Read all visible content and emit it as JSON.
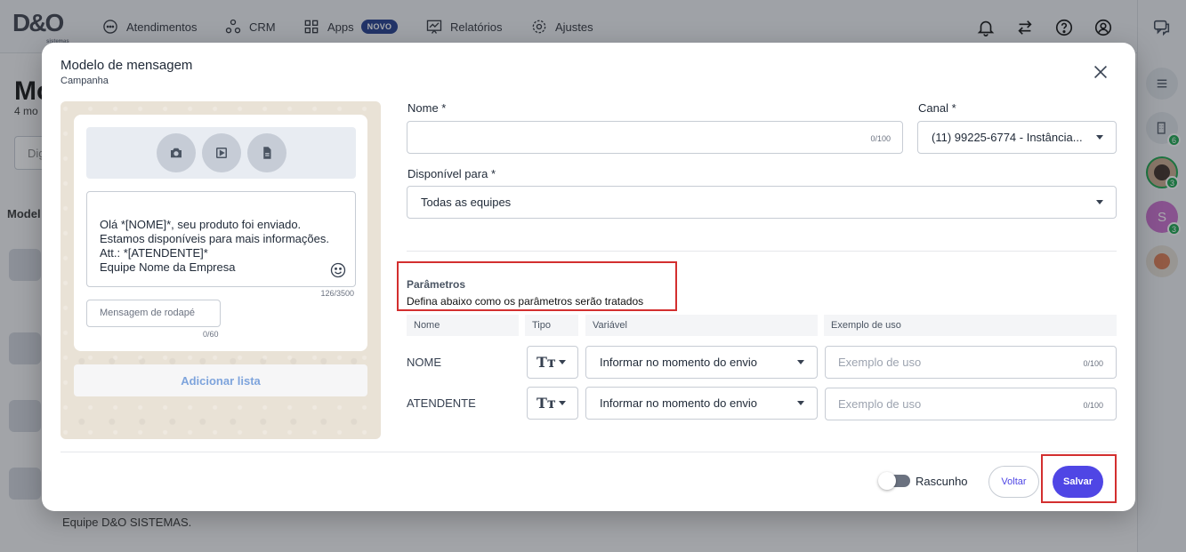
{
  "topnav": {
    "logo": "D&O",
    "logo_sub": "sistemas",
    "items": [
      {
        "label": "Atendimentos"
      },
      {
        "label": "CRM"
      },
      {
        "label": "Apps",
        "badge": "NOVO"
      },
      {
        "label": "Relatórios"
      },
      {
        "label": "Ajustes"
      }
    ]
  },
  "rail": {
    "counts": [
      "6",
      "3",
      "3"
    ],
    "avatar_letter": "S"
  },
  "background": {
    "title": "Mo",
    "subtitle": "4 mo",
    "search_placeholder": "Dig",
    "column": "Model",
    "footer_text": "Equipe D&O SISTEMAS."
  },
  "modal": {
    "title": "Modelo de mensagem",
    "subtitle": "Campanha",
    "preview": {
      "message": "Olá *[NOME]*, seu produto foi enviado.\nEstamos disponíveis para mais informações.\nAtt.: *[ATENDENTE]*\nEquipe Nome da Empresa",
      "message_count": "126/3500",
      "footer_placeholder": "Mensagem de rodapé",
      "footer_count": "0/60",
      "add_list_label": "Adicionar lista"
    },
    "form": {
      "name_label": "Nome *",
      "name_value": "",
      "name_count": "0/100",
      "channel_label": "Canal *",
      "channel_value": "(11) 99225-6774 - Instância...",
      "available_label": "Disponível para *",
      "available_value": "Todas as equipes"
    },
    "params": {
      "title": "Parâmetros",
      "description": "Defina abaixo como os parâmetros serão tratados",
      "headers": {
        "name": "Nome",
        "type": "Tipo",
        "variable": "Variável",
        "example": "Exemplo de uso"
      },
      "rows": [
        {
          "name": "NOME",
          "type_glyph": "Tт",
          "variable": "Informar no momento do envio",
          "example_placeholder": "Exemplo de uso",
          "example_count": "0/100"
        },
        {
          "name": "ATENDENTE",
          "type_glyph": "Tт",
          "variable": "Informar no momento do envio",
          "example_placeholder": "Exemplo de uso",
          "example_count": "0/100"
        }
      ]
    },
    "footer": {
      "draft_label": "Rascunho",
      "back_label": "Voltar",
      "save_label": "Salvar"
    }
  },
  "colors": {
    "primary": "#4f46e5",
    "highlight": "#d32f2f",
    "add_list_text": "#7ea4dc"
  }
}
